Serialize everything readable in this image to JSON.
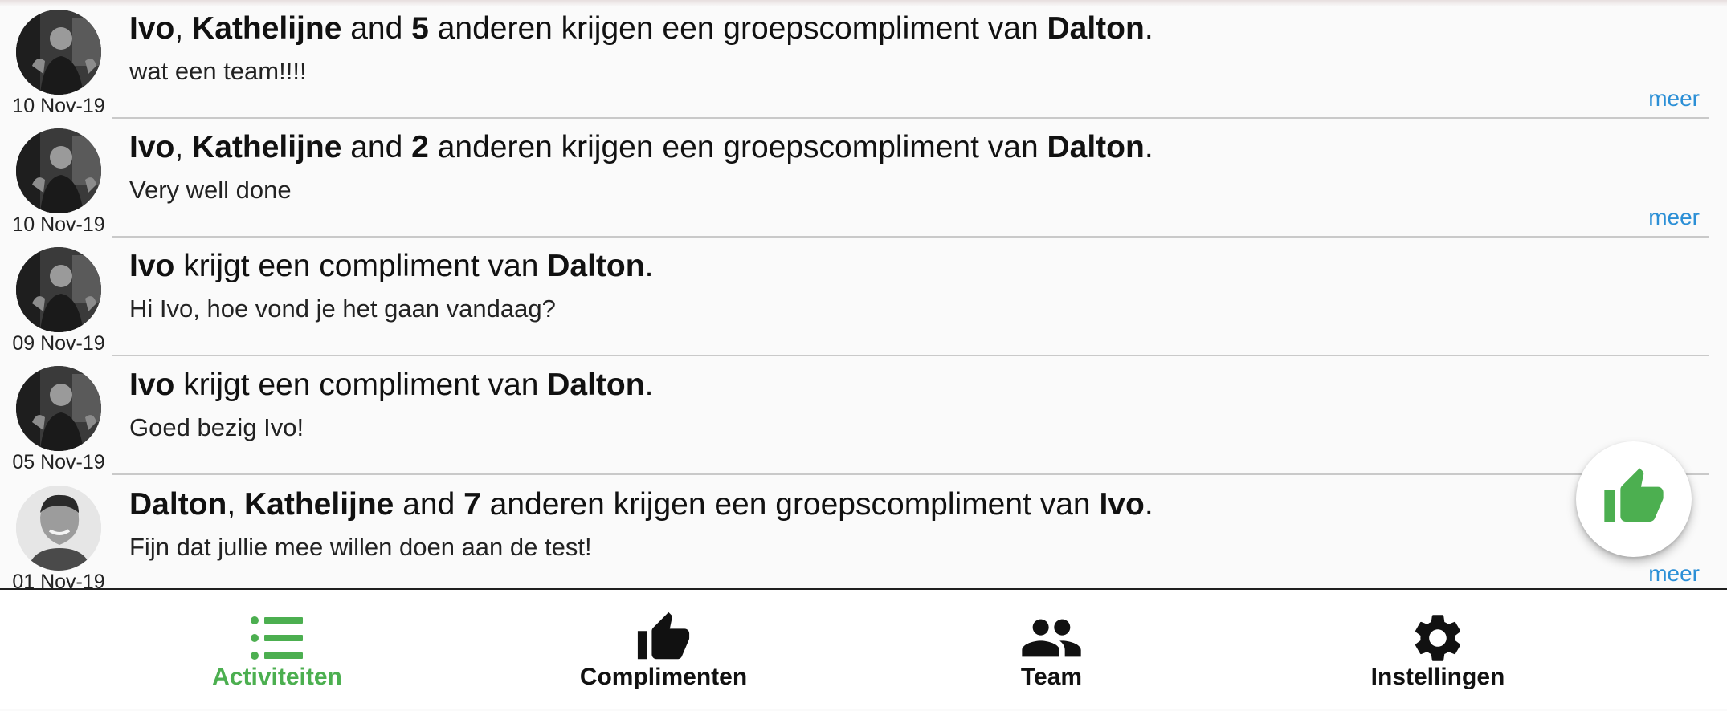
{
  "feed": {
    "items": [
      {
        "date": "10 Nov-19",
        "headline": [
          {
            "text": "Ivo",
            "bold": true
          },
          {
            "text": ", ",
            "bold": false
          },
          {
            "text": "Kathelijne",
            "bold": true
          },
          {
            "text": " and ",
            "bold": false
          },
          {
            "text": "5",
            "bold": true
          },
          {
            "text": " anderen krijgen een groepscompliment van ",
            "bold": false
          },
          {
            "text": "Dalton",
            "bold": true
          },
          {
            "text": ".",
            "bold": false
          }
        ],
        "message": "wat een team!!!!",
        "more": "meer"
      },
      {
        "date": "10 Nov-19",
        "headline": [
          {
            "text": "Ivo",
            "bold": true
          },
          {
            "text": ", ",
            "bold": false
          },
          {
            "text": "Kathelijne",
            "bold": true
          },
          {
            "text": " and ",
            "bold": false
          },
          {
            "text": "2",
            "bold": true
          },
          {
            "text": " anderen krijgen een groepscompliment van ",
            "bold": false
          },
          {
            "text": "Dalton",
            "bold": true
          },
          {
            "text": ".",
            "bold": false
          }
        ],
        "message": "Very well done",
        "more": "meer"
      },
      {
        "date": "09 Nov-19",
        "headline": [
          {
            "text": "Ivo",
            "bold": true
          },
          {
            "text": " krijgt een compliment van ",
            "bold": false
          },
          {
            "text": "Dalton",
            "bold": true
          },
          {
            "text": ".",
            "bold": false
          }
        ],
        "message": "Hi Ivo, hoe vond je het gaan vandaag?",
        "more": ""
      },
      {
        "date": "05 Nov-19",
        "headline": [
          {
            "text": "Ivo",
            "bold": true
          },
          {
            "text": " krijgt een compliment van ",
            "bold": false
          },
          {
            "text": "Dalton",
            "bold": true
          },
          {
            "text": ".",
            "bold": false
          }
        ],
        "message": "Goed bezig Ivo!",
        "more": ""
      },
      {
        "date": "01 Nov-19",
        "headline": [
          {
            "text": "Dalton",
            "bold": true
          },
          {
            "text": ", ",
            "bold": false
          },
          {
            "text": "Kathelijne",
            "bold": true
          },
          {
            "text": " and ",
            "bold": false
          },
          {
            "text": "7",
            "bold": true
          },
          {
            "text": " anderen krijgen een groepscompliment van ",
            "bold": false
          },
          {
            "text": "Ivo",
            "bold": true
          },
          {
            "text": ".",
            "bold": false
          }
        ],
        "message": "Fijn dat jullie mee willen doen aan de test!",
        "more": "meer"
      }
    ]
  },
  "fab": {
    "icon": "thumbs-up-icon",
    "color": "#4caf50"
  },
  "nav": {
    "items": [
      {
        "label": "Activiteiten",
        "icon": "list-icon",
        "active": true
      },
      {
        "label": "Complimenten",
        "icon": "thumbs-up-icon",
        "active": false
      },
      {
        "label": "Team",
        "icon": "people-icon",
        "active": false
      },
      {
        "label": "Instellingen",
        "icon": "gear-icon",
        "active": false
      }
    ],
    "active_color": "#4caf50",
    "link_color": "#2b8fd6"
  }
}
